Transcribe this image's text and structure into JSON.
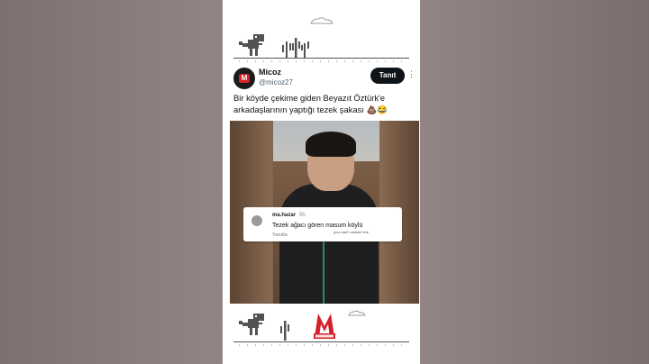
{
  "post": {
    "author_name": "Micoz",
    "author_handle": "@micoz27",
    "follow_label": "Tanıt",
    "more_icon": "⋮",
    "text": "Bir köyde çekime giden Beyazıt Öztürk'e arkadaşlarının yaptığı tezek şakası 💩😂"
  },
  "comment": {
    "user": "ma.hazar",
    "time": "5h",
    "text": "Tezek ağacı gören masum köylü",
    "signature": "you can't cancel me",
    "reply_label": "Yanıtla"
  },
  "avatar_logo": "M",
  "colors": {
    "follow_bg": "#0f1419",
    "brand_red": "#d3202a",
    "dino": "#535353"
  }
}
